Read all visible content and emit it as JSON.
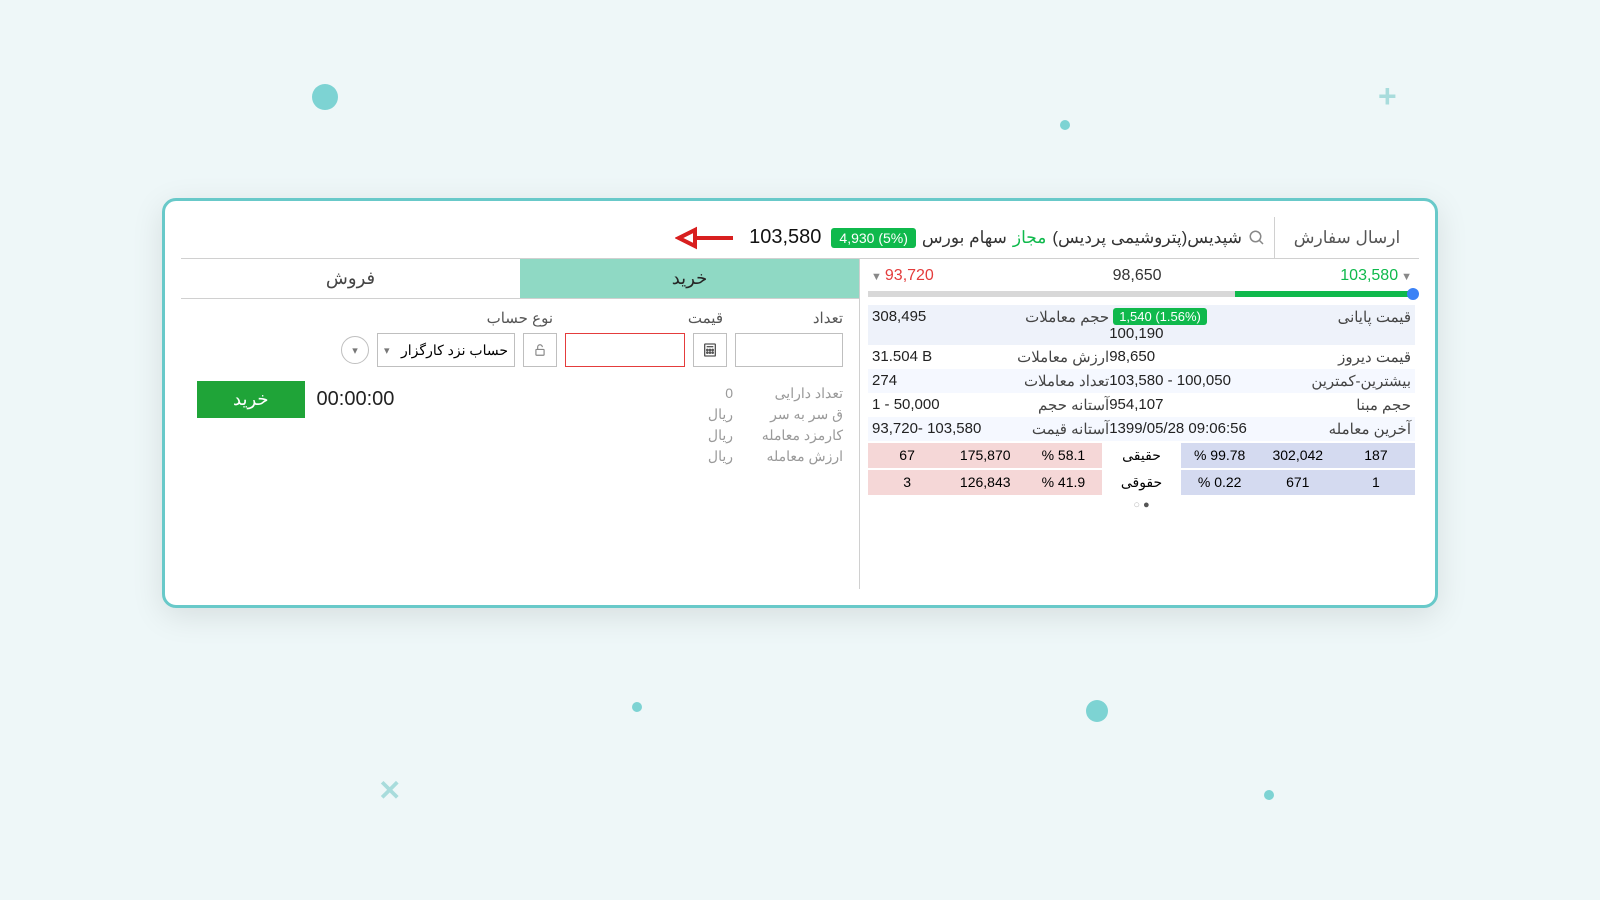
{
  "topbar": {
    "send_order": "ارسال سفارش",
    "stock_name": "شپدیس(پتروشیمی پردیس)",
    "status": "مجاز",
    "exchange": "سهام بورس",
    "badge": "4,930 (5%)",
    "top_price": "103,580"
  },
  "slider": {
    "low": "93,720",
    "mid": "98,650",
    "high": "103,580"
  },
  "stats": {
    "final_price_label": "قیمت پایانی",
    "final_price_badge": "1,540 (1.56%)",
    "final_price_val": "100,190",
    "trade_vol_label": "حجم معاملات",
    "trade_vol_val": "308,495",
    "yesterday_label": "قیمت دیروز",
    "yesterday_val": "98,650",
    "trade_value_label": "ارزش معاملات",
    "trade_value_val": "31.504 B",
    "highlow_label": "بیشترین-کمترین",
    "highlow_val": "103,580 - 100,050",
    "trade_count_label": "تعداد معاملات",
    "trade_count_val": "274",
    "base_vol_label": "حجم مبنا",
    "base_vol_val": "954,107",
    "vol_threshold_label": "آستانه حجم",
    "vol_threshold_val": "1 - 50,000",
    "last_trade_label": "آخرین معامله",
    "last_trade_val": "1399/05/28 09:06:56",
    "price_threshold_label": "آستانه قیمت",
    "price_threshold_val": "93,720- 103,580"
  },
  "bottom": {
    "row1": {
      "c1": "187",
      "c2": "302,042",
      "c3": "99.78 %",
      "type": "حقیقی",
      "c5": "58.1 %",
      "c6": "175,870",
      "c7": "67"
    },
    "row2": {
      "c1": "1",
      "c2": "671",
      "c3": "0.22 %",
      "type": "حقوقی",
      "c5": "41.9 %",
      "c6": "126,843",
      "c7": "3"
    }
  },
  "tabs": {
    "buy": "خرید",
    "sell": "فروش"
  },
  "form": {
    "qty_label": "تعداد",
    "price_label": "قیمت",
    "account_type_label": "نوع حساب",
    "account_sel": "حساب نزد کارگزار",
    "asset_count_label": "تعداد دارایی",
    "asset_count_val": "0",
    "break_even_label": "ق سر به سر",
    "break_even_val": "ریال",
    "fee_label": "کارمزد معامله",
    "fee_val": "ریال",
    "trade_value_label": "ارزش معامله",
    "trade_value_val": "ریال",
    "timer": "00:00:00",
    "buy_btn": "خرید"
  }
}
